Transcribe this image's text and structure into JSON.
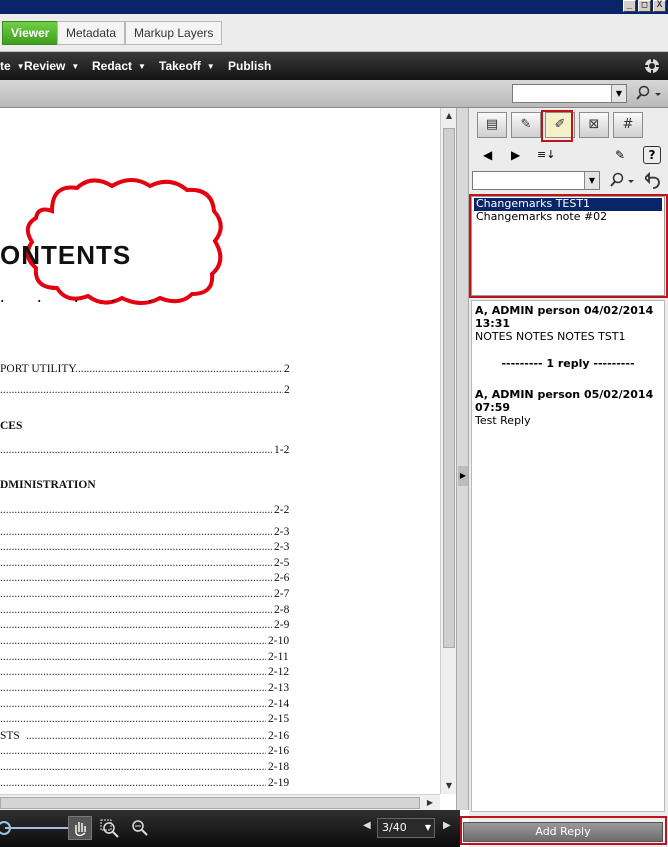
{
  "window": {
    "min_btn": "_",
    "max_btn": "□",
    "close_btn": "X"
  },
  "tabs": [
    {
      "label": "Viewer",
      "active": true
    },
    {
      "label": "Metadata",
      "active": false
    },
    {
      "label": "Markup Layers",
      "active": false
    }
  ],
  "menu": {
    "items": [
      {
        "label": "te",
        "has_caret": true
      },
      {
        "label": "Review",
        "has_caret": true
      },
      {
        "label": "Redact",
        "has_caret": true
      },
      {
        "label": "Takeoff",
        "has_caret": true
      },
      {
        "label": "Publish",
        "has_caret": false
      }
    ]
  },
  "document": {
    "heading": "ONTENTS",
    "heading_dots": ". . .   .   .",
    "entries": [
      {
        "text": "PORT UTILITY",
        "page": "2",
        "bold": false
      },
      {
        "text": "",
        "page": "2",
        "bold": false
      },
      {
        "text": "CES",
        "page": "",
        "bold": true
      },
      {
        "text": "",
        "page": "1-2",
        "bold": false
      },
      {
        "text": "DMINISTRATION",
        "page": "",
        "bold": true
      },
      {
        "text": "",
        "page": "2-2",
        "bold": false
      },
      {
        "text": "",
        "page": "2-3",
        "bold": false
      },
      {
        "text": "",
        "page": "2-3",
        "bold": false
      },
      {
        "text": "",
        "page": "2-5",
        "bold": false
      },
      {
        "text": "",
        "page": "2-6",
        "bold": false
      },
      {
        "text": "",
        "page": "2-7",
        "bold": false
      },
      {
        "text": "",
        "page": "2-8",
        "bold": false
      },
      {
        "text": "",
        "page": "2-9",
        "bold": false
      },
      {
        "text": "",
        "page": "2-10",
        "bold": false
      },
      {
        "text": "",
        "page": "2-11",
        "bold": false
      },
      {
        "text": "",
        "page": "2-12",
        "bold": false
      },
      {
        "text": "",
        "page": "2-13",
        "bold": false
      },
      {
        "text": "",
        "page": "2-14",
        "bold": false
      },
      {
        "text": "",
        "page": "2-15",
        "bold": false
      },
      {
        "text": "STS",
        "page": "2-16",
        "bold": false
      },
      {
        "text": "",
        "page": "2-16",
        "bold": false
      },
      {
        "text": "",
        "page": "2-18",
        "bold": false
      },
      {
        "text": "",
        "page": "2-19",
        "bold": false
      }
    ]
  },
  "statusbar": {
    "page_indicator": "3/40"
  },
  "panel": {
    "markups": [
      {
        "label": "Changemarks TEST1",
        "selected": true
      },
      {
        "label": "Changemarks note #02",
        "selected": false
      }
    ],
    "notes": [
      {
        "author_date": "A, ADMIN person 04/02/2014 13:31",
        "body": "NOTES NOTES NOTES TST1"
      }
    ],
    "reply_separator": "--------- 1 reply ---------",
    "replies": [
      {
        "author_date": "A, ADMIN person 05/02/2014 07:59",
        "body": "Test Reply"
      }
    ],
    "add_reply_label": "Add Reply",
    "help_glyph": "?"
  },
  "colors": {
    "accent_green": "#3f9e1d",
    "highlight_red": "#c0121b",
    "selection_blue": "#0a246a"
  }
}
